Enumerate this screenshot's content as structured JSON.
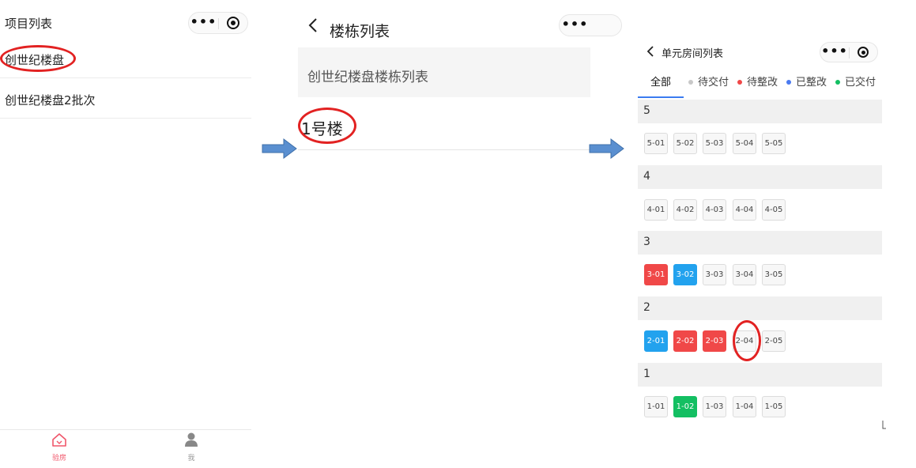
{
  "panel1": {
    "title": "项目列表",
    "items": [
      {
        "label": "创世纪楼盘"
      },
      {
        "label": "创世纪楼盘2批次"
      }
    ],
    "tabbar": {
      "house_label": "验房",
      "me_label": "我",
      "active_color": "#f0566a"
    }
  },
  "panel2": {
    "title": "楼栋列表",
    "header": "创世纪楼盘楼栋列表",
    "buildings": [
      {
        "label": "1号楼"
      }
    ]
  },
  "panel3": {
    "title": "单元房间列表",
    "tabs": [
      {
        "label": "全部",
        "dot": null
      },
      {
        "label": "待交付",
        "dot": "#c8c8c8"
      },
      {
        "label": "待整改",
        "dot": "#f04848"
      },
      {
        "label": "已整改",
        "dot": "#4a7af0"
      },
      {
        "label": "已交付",
        "dot": "#13bf62"
      }
    ],
    "floors": [
      {
        "floor": "5",
        "rooms": [
          "5-01",
          "5-02",
          "5-03",
          "5-04",
          "5-05"
        ],
        "status": [
          "none",
          "none",
          "none",
          "none",
          "none"
        ]
      },
      {
        "floor": "4",
        "rooms": [
          "4-01",
          "4-02",
          "4-03",
          "4-04",
          "4-05"
        ],
        "status": [
          "none",
          "none",
          "none",
          "none",
          "none"
        ]
      },
      {
        "floor": "3",
        "rooms": [
          "3-01",
          "3-02",
          "3-03",
          "3-04",
          "3-05"
        ],
        "status": [
          "red",
          "blue",
          "none",
          "none",
          "none"
        ]
      },
      {
        "floor": "2",
        "rooms": [
          "2-01",
          "2-02",
          "2-03",
          "2-04",
          "2-05"
        ],
        "status": [
          "blue",
          "red",
          "red",
          "none",
          "none"
        ]
      },
      {
        "floor": "1",
        "rooms": [
          "1-01",
          "1-02",
          "1-03",
          "1-04",
          "1-05"
        ],
        "status": [
          "none",
          "green",
          "none",
          "none",
          "none"
        ]
      }
    ]
  },
  "colors": {
    "highlight_ring": "#e22222",
    "arrow_fill": "#5a8fd0",
    "arrow_stroke": "#3f6fa9"
  }
}
